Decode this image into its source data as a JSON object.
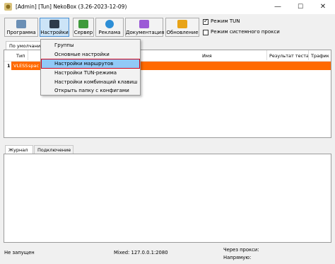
{
  "window": {
    "title": "[Admin] [Tun] NekoBox (3.26-2023-12-09)",
    "minimize_glyph": "—",
    "maximize_glyph": "☐",
    "close_glyph": "✕"
  },
  "toolbar": {
    "buttons": [
      {
        "label": "Программа",
        "icon": "program-icon",
        "color": "#6b8fb5"
      },
      {
        "label": "Настройки",
        "icon": "settings-icon",
        "color": "#2d3b4b"
      },
      {
        "label": "Сервер",
        "icon": "server-icon",
        "color": "#3f9a3b"
      },
      {
        "label": "Реклама",
        "icon": "globe-icon",
        "color": "#2d8ed6"
      },
      {
        "label": "Документация",
        "icon": "docs-icon",
        "color": "#9b5ad6"
      },
      {
        "label": "Обновление",
        "icon": "update-icon",
        "color": "#e8a317"
      }
    ],
    "checkboxes": [
      {
        "label": "Режим TUN",
        "checked": true
      },
      {
        "label": "Режим системного прокси",
        "checked": false
      }
    ]
  },
  "groups": {
    "tab_label": "По умолчанию"
  },
  "table": {
    "columns": [
      "Тип",
      "Имя",
      "Результат теста",
      "Трафик"
    ],
    "rows": [
      {
        "index": "1",
        "type": "VLESS",
        "address": "spac"
      }
    ]
  },
  "settings_menu": {
    "items": [
      {
        "label": "Группы",
        "highlighted": false
      },
      {
        "label": "Основные настройки",
        "highlighted": false
      },
      {
        "label": "Настройки маршрутов",
        "highlighted": true
      },
      {
        "label": "Настройки TUN-режима",
        "highlighted": false
      },
      {
        "label": "Настройки комбинаций клавиш",
        "highlighted": false
      },
      {
        "label": "Открыть папку с конфигами",
        "highlighted": false
      }
    ]
  },
  "bottom_tabs": [
    "Журнал",
    "Подключение"
  ],
  "status": {
    "state": "Не запущен",
    "mixed": "Mixed: 127.0.0.1:2080",
    "via_proxy": "Через прокси:",
    "direct": "Напрямую:"
  },
  "colors": {
    "selected_row": "#ff6a00",
    "menu_highlight": "#91c9f7",
    "highlight_outline": "#d0021b"
  }
}
